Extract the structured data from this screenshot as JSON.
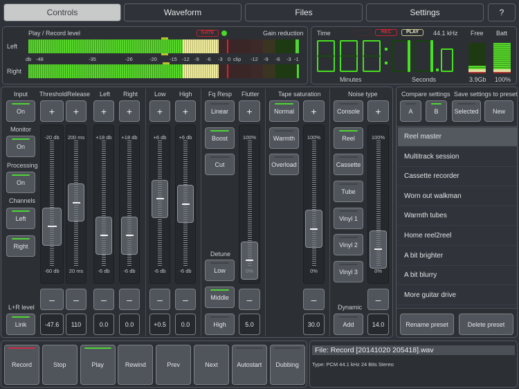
{
  "tabs": [
    {
      "label": "Controls",
      "active": true
    },
    {
      "label": "Waveform"
    },
    {
      "label": "Files"
    },
    {
      "label": "Settings"
    },
    {
      "label": "?"
    }
  ],
  "levels": {
    "title": "Play / Record level",
    "gate_label": "GATE",
    "gain_reduction_label": "Gain reduction",
    "left_label": "Left",
    "right_label": "Right",
    "db_label": "db",
    "scale": [
      "-48",
      "-35",
      "-26",
      "-20",
      "-15",
      "-12",
      "-9",
      "-6",
      "-3",
      "0",
      "clip"
    ],
    "gr_scale": [
      "-12",
      "-9",
      "-6",
      "-3",
      "-1"
    ],
    "left_peak_db": -18,
    "right_peak_db": -17.5
  },
  "time": {
    "label": "Time",
    "indicators": [
      "REC",
      "PLAY"
    ],
    "sample_rate": "44.1 kHz",
    "display": "000:11.0",
    "minutes_label": "Minutes",
    "seconds_label": "Seconds",
    "free_label": "Free",
    "free_value": "3.9Gb",
    "free_fraction": 0.25,
    "batt_label": "Batt",
    "batt_value": "100%",
    "batt_fraction": 1.0
  },
  "controls": {
    "input_label": "Input",
    "input_btn": "On",
    "monitor_label": "Monitor",
    "monitor_btn": "On",
    "processing_label": "Processing",
    "processing_btn": "On",
    "channels_label": "Channels",
    "channel_left": "Left",
    "channel_right": "Right",
    "lr_label": "L+R level",
    "link_btn": "Link",
    "plus": "+",
    "minus": "–",
    "sliders": [
      {
        "label": "Threshold",
        "top": "-20 db",
        "bottom": "-60 db",
        "value": "-47.6",
        "fraction": 0.32
      },
      {
        "label": "Release",
        "top": "200 ms",
        "bottom": "20 ms",
        "value": "110",
        "fraction": 0.51
      },
      {
        "label": "Left",
        "top": "+18 db",
        "bottom": "-6 db",
        "value": "0.0",
        "fraction": 0.25
      },
      {
        "label": "Right",
        "top": "+18 db",
        "bottom": "-6 db",
        "value": "0.0",
        "fraction": 0.25
      },
      {
        "label": "Low",
        "top": "+6 db",
        "bottom": "-6 db",
        "value": "+0.5",
        "fraction": 0.54
      },
      {
        "label": "High",
        "top": "+6 db",
        "bottom": "-6 db",
        "value": "0.0",
        "fraction": 0.5
      },
      {
        "label": "Flutter",
        "top": "100%",
        "bottom": "0%",
        "value": "5.0",
        "fraction": 0.05
      },
      {
        "label": "",
        "top": "100%",
        "bottom": "0%",
        "value": "30.0",
        "fraction": 0.3
      },
      {
        "label": "",
        "top": "100%",
        "bottom": "0%",
        "value": "14.0",
        "fraction": 0.14
      }
    ],
    "fq_label": "Fq Resp",
    "fq_btns": [
      "Linear",
      "Boost",
      "Cut"
    ],
    "detune_label": "Detune",
    "detune_btns": [
      "Low",
      "Middle",
      "High"
    ],
    "tape_label": "Tape saturation",
    "tape_btns": [
      "Normal",
      "Warmth",
      "Overload"
    ],
    "noise_label": "Noise type",
    "noise_btns": [
      "Console",
      "Reel",
      "Cassette",
      "Tube",
      "Vinyl 1",
      "Vinyl 2",
      "Vinyl 3"
    ],
    "dynamic_label": "Dynamic",
    "dynamic_btn": "Add"
  },
  "presets": {
    "compare_label": "Compare settings",
    "compare_a": "A",
    "compare_b": "B",
    "save_label": "Save settings to preset",
    "save_selected": "Selected",
    "save_new": "New",
    "items": [
      "Reel master",
      "Multitrack session",
      "Cassette recorder",
      "Worn out walkman",
      "Warmth tubes",
      "Home reel2reel",
      "A bit brighter",
      "A bit blurry",
      "More guitar drive"
    ],
    "selected": "Reel master",
    "rename": "Rename preset",
    "delete": "Delete preset"
  },
  "transport": [
    "Record",
    "Stop",
    "Play",
    "Rewind",
    "Prev",
    "Next",
    "Autostart",
    "Dubbing"
  ],
  "file": {
    "name": "File: Record [20141020 205418].wav",
    "type": "Type: PCM 44.1 kHz 24 Bits Stereo"
  },
  "colors": {
    "led_green": "#4fd633",
    "led_red": "#d02b45",
    "meter_green": "#56d62a",
    "meter_yellow": "#f0ec9e",
    "digit_green": "#47e11f"
  }
}
